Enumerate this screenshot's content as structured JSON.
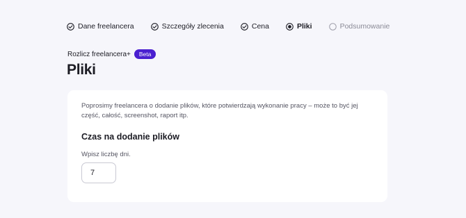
{
  "stepper": {
    "steps": [
      {
        "label": "Dane freelancera",
        "status": "done",
        "icon": "check-circle-icon"
      },
      {
        "label": "Szczegóły zlecenia",
        "status": "done",
        "icon": "check-circle-icon"
      },
      {
        "label": "Cena",
        "status": "done",
        "icon": "check-circle-icon"
      },
      {
        "label": "Pliki",
        "status": "active",
        "icon": "radio-filled-icon"
      },
      {
        "label": "Podsumowanie",
        "status": "pending",
        "icon": "radio-empty-icon"
      }
    ]
  },
  "header": {
    "product": "Rozlicz freelancera+",
    "badge": "Beta",
    "title": "Pliki"
  },
  "card": {
    "description": "Poprosimy freelancera o dodanie plików, które potwierdzają wykonanie pracy – może to być jej część, całość, screenshot, raport itp.",
    "section_title": "Czas na dodanie plików",
    "input_label": "Wpisz liczbę dni.",
    "input_value": "7"
  },
  "colors": {
    "accent": "#4a1fd0",
    "background": "#f6f6fb",
    "card": "#ffffff"
  }
}
